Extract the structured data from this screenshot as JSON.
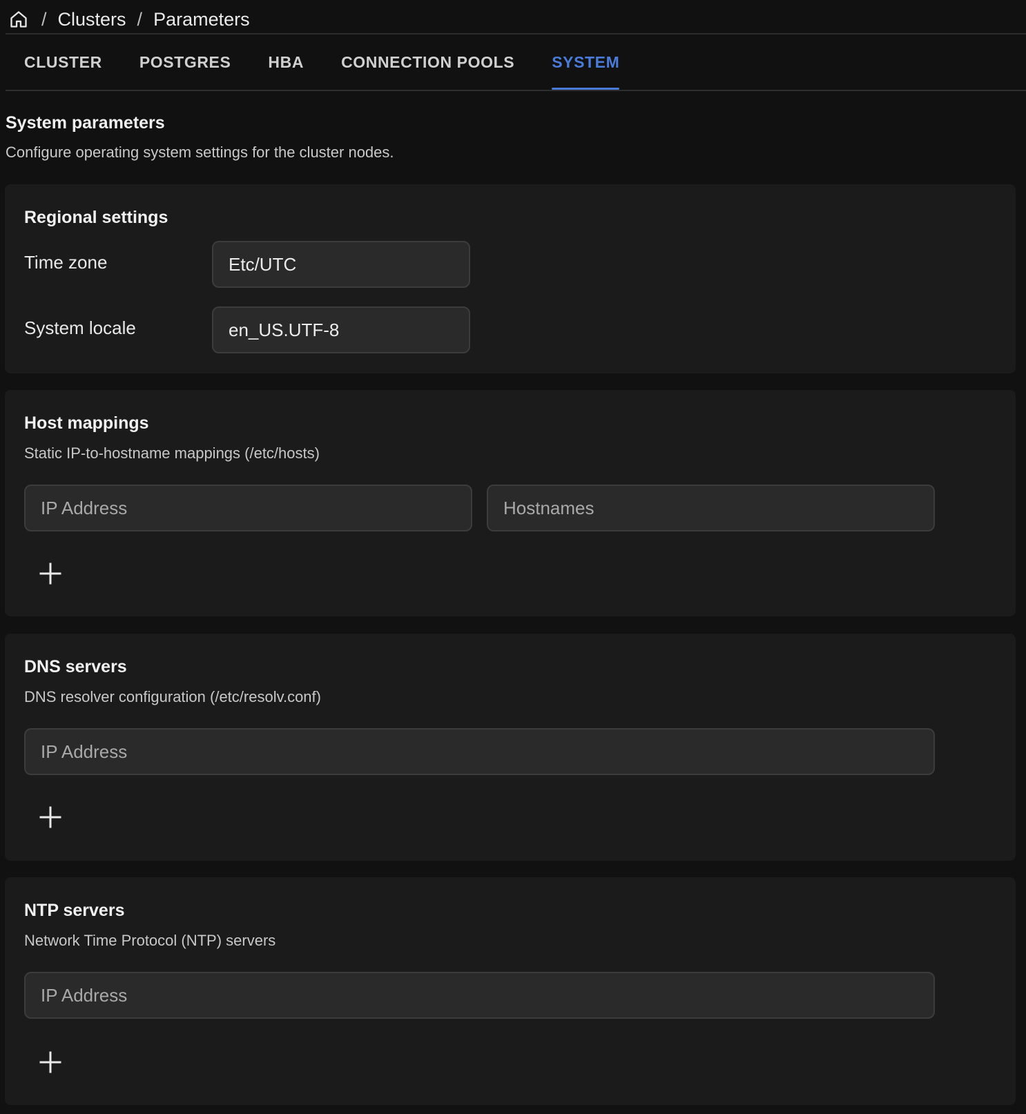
{
  "breadcrumb": {
    "home_icon": "home-icon",
    "separator": "/",
    "items": [
      "Clusters",
      "Parameters"
    ]
  },
  "tabs": [
    {
      "label": "CLUSTER",
      "active": false
    },
    {
      "label": "POSTGRES",
      "active": false
    },
    {
      "label": "HBA",
      "active": false
    },
    {
      "label": "CONNECTION POOLS",
      "active": false
    },
    {
      "label": "SYSTEM",
      "active": true
    }
  ],
  "accent_color": "#4b7bd9",
  "page": {
    "title": "System parameters",
    "subtitle": "Configure operating system settings for the cluster nodes."
  },
  "regional": {
    "title": "Regional settings",
    "timezone_label": "Time zone",
    "timezone_value": "Etc/UTC",
    "locale_label": "System locale",
    "locale_value": "en_US.UTF-8"
  },
  "hosts": {
    "title": "Host mappings",
    "desc": "Static IP-to-hostname mappings (/etc/hosts)",
    "ip_placeholder": "IP Address",
    "hostnames_placeholder": "Hostnames",
    "add_icon": "plus-icon"
  },
  "dns": {
    "title": "DNS servers",
    "desc": "DNS resolver configuration (/etc/resolv.conf)",
    "ip_placeholder": "IP Address",
    "add_icon": "plus-icon"
  },
  "ntp": {
    "title": "NTP servers",
    "desc": "Network Time Protocol (NTP) servers",
    "ip_placeholder": "IP Address",
    "add_icon": "plus-icon"
  }
}
